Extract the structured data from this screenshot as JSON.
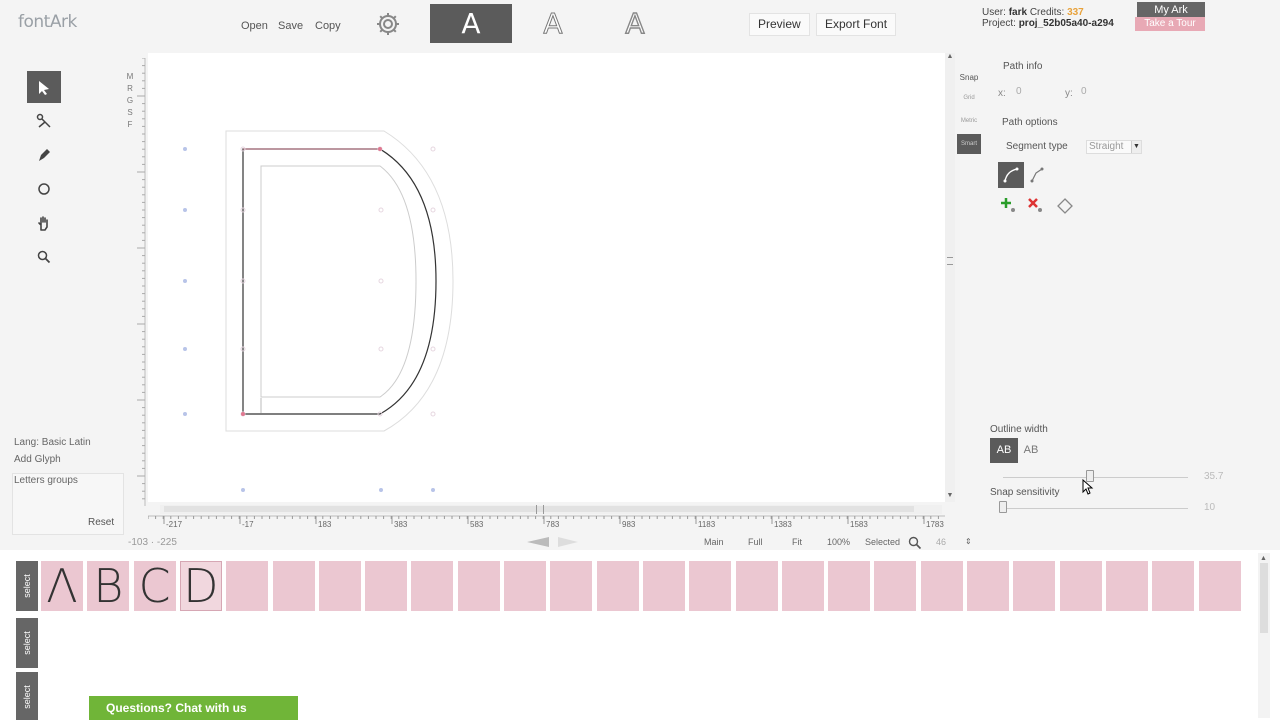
{
  "app": {
    "logo": "fontArk"
  },
  "toolbar": {
    "open": "Open",
    "save": "Save",
    "copy": "Copy",
    "tab_glyph_1": "A",
    "tab_glyph_2": "A",
    "tab_glyph_3": "A",
    "preview": "Preview",
    "export": "Export Font"
  },
  "account": {
    "user_label": "User:",
    "user": "fark",
    "credits_label": "Credits:",
    "credits": "337",
    "project_label": "Project:",
    "project": "proj_52b05a40-a294",
    "my_ark": "My Ark",
    "tour": "Take a Tour"
  },
  "left": {
    "tools": [
      "select-arrow",
      "scissors",
      "pen",
      "circle",
      "hand",
      "zoom"
    ],
    "side_letters": [
      "M",
      "R",
      "G",
      "S",
      "F"
    ],
    "lang": "Lang: Basic Latin",
    "add_glyph": "Add Glyph",
    "letters_groups": "Letters groups",
    "reset": "Reset"
  },
  "canvas": {
    "ruler_h": [
      "-217",
      "-17",
      "183",
      "383",
      "583",
      "783",
      "983",
      "1183",
      "1383",
      "1583",
      "1783"
    ],
    "coords": "-103 · -225",
    "snap": {
      "label": "Snap",
      "options": [
        "Grid",
        "Metric",
        "Smart"
      ],
      "active": "Smart"
    }
  },
  "zoom": {
    "main": "Main",
    "full": "Full",
    "fit": "Fit",
    "percent": "100%",
    "selected": "Selected",
    "value": "46"
  },
  "path_info": {
    "title": "Path info",
    "x_label": "x:",
    "x": "0",
    "y_label": "y:",
    "y": "0"
  },
  "path_options": {
    "title": "Path options",
    "segment_label": "Segment type",
    "segment_value": "Straight"
  },
  "outline": {
    "title": "Outline width",
    "btn1": "AB",
    "btn2": "AB",
    "width_value": "35.7",
    "width_fraction": 0.47,
    "snap_title": "Snap sensitivity",
    "snap_value": "10",
    "snap_fraction": 0.0
  },
  "glyphs": {
    "select_label": "select",
    "items": [
      "Λ",
      "B",
      "C",
      "D"
    ],
    "current": "D",
    "empty_slots": 22
  },
  "chat": {
    "label": "Questions? Chat with us"
  },
  "colors": {
    "accent_dark": "#5b5b5b",
    "pink_slot": "#ebc7d1",
    "chat_green": "#70b538",
    "credits": "#e8a23b"
  }
}
